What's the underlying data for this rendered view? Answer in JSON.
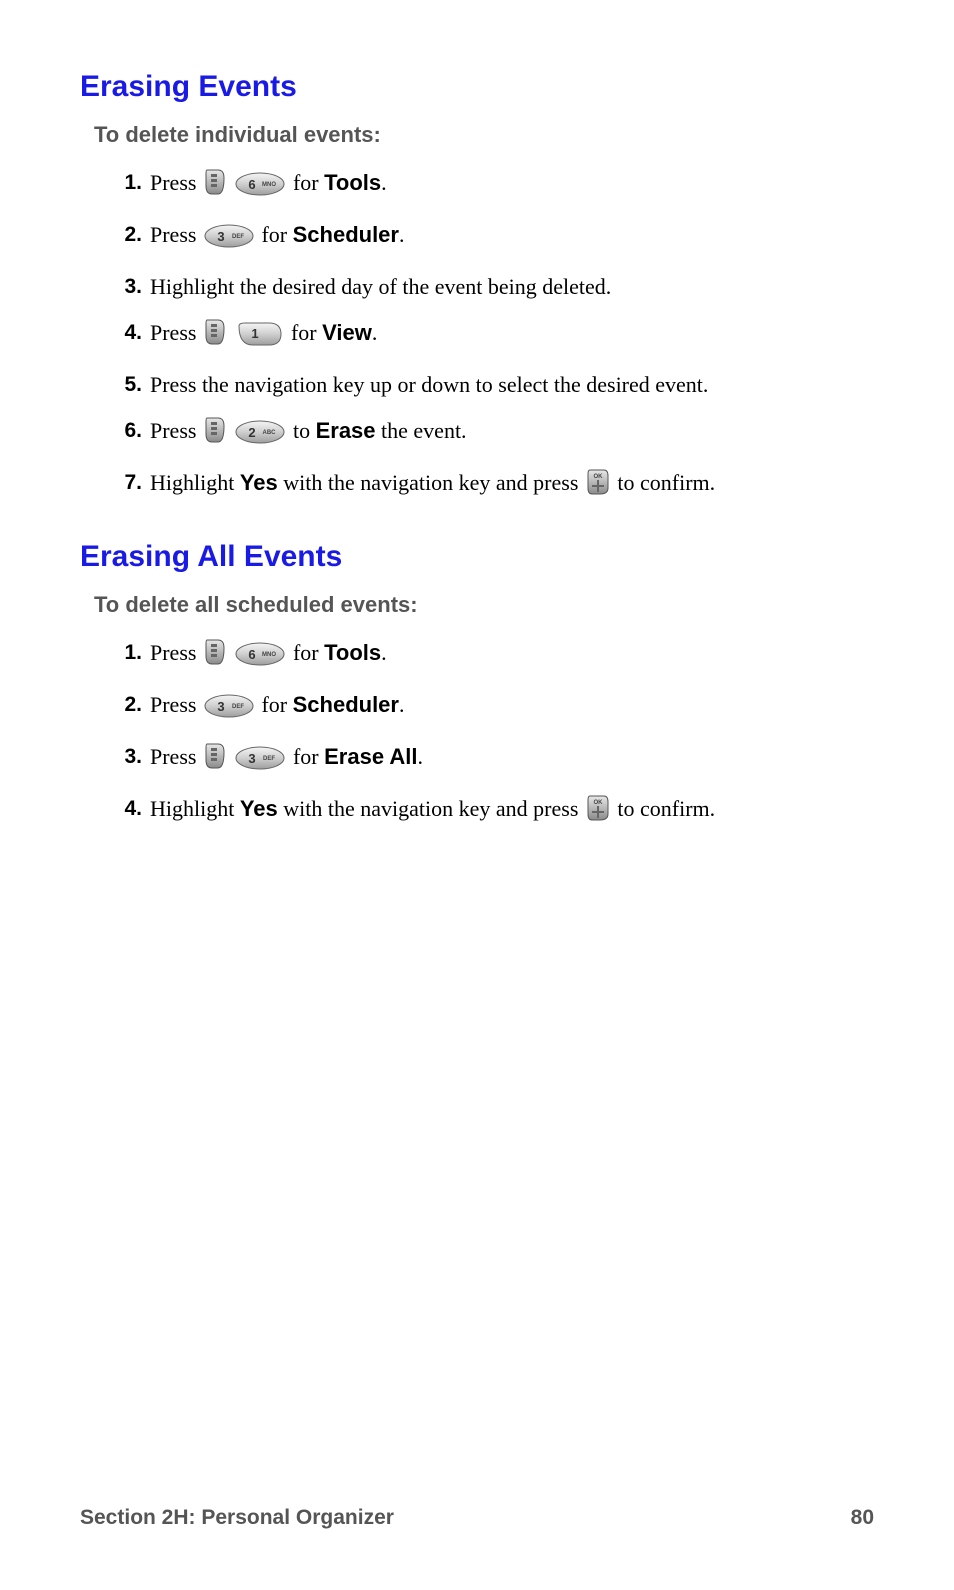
{
  "section1": {
    "heading": "Erasing Events",
    "subheading": "To delete individual events:",
    "steps": [
      {
        "n": "1.",
        "before": "Press ",
        "icons": [
          "menu-key",
          "key-6"
        ],
        "mid": " for ",
        "bold": "Tools",
        "after": "."
      },
      {
        "n": "2.",
        "before": "Press ",
        "icons": [
          "key-3"
        ],
        "mid": " for ",
        "bold": "Scheduler",
        "after": "."
      },
      {
        "n": "3.",
        "before": "Highlight the desired day of the event being deleted.",
        "icons": [],
        "mid": "",
        "bold": "",
        "after": ""
      },
      {
        "n": "4.",
        "before": "Press ",
        "icons": [
          "menu-key",
          "key-1"
        ],
        "mid": " for ",
        "bold": "View",
        "after": "."
      },
      {
        "n": "5.",
        "before": "Press the navigation key up or down to select the desired event.",
        "icons": [],
        "mid": "",
        "bold": "",
        "after": ""
      },
      {
        "n": "6.",
        "before": "Press ",
        "icons": [
          "menu-key",
          "key-2"
        ],
        "mid": " to ",
        "bold": "Erase",
        "after": " the event."
      },
      {
        "n": "7.",
        "before": "Highlight ",
        "preBold": "Yes",
        "preAfter": " with the navigation key and press ",
        "icons": [
          "ok-key"
        ],
        "mid": "",
        "bold": "",
        "after": " to confirm."
      }
    ]
  },
  "section2": {
    "heading": "Erasing All Events",
    "subheading": "To delete all scheduled events:",
    "steps": [
      {
        "n": "1.",
        "before": "Press ",
        "icons": [
          "menu-key",
          "key-6"
        ],
        "mid": " for ",
        "bold": "Tools",
        "after": "."
      },
      {
        "n": "2.",
        "before": "Press ",
        "icons": [
          "key-3"
        ],
        "mid": " for ",
        "bold": "Scheduler",
        "after": "."
      },
      {
        "n": "3.",
        "before": "Press ",
        "icons": [
          "menu-key",
          "key-3"
        ],
        "mid": " for ",
        "bold": "Erase All",
        "after": "."
      },
      {
        "n": "4.",
        "before": "Highlight ",
        "preBold": "Yes",
        "preAfter": " with the navigation key and press ",
        "icons": [
          "ok-key"
        ],
        "mid": "",
        "bold": "",
        "after": " to confirm."
      }
    ]
  },
  "footer": {
    "left": "Section 2H: Personal Organizer",
    "right": "80"
  },
  "keyLabels": {
    "key-1": "1",
    "key-2": "2 ABC",
    "key-3": "3 DEF",
    "key-6": "6 MNO"
  }
}
